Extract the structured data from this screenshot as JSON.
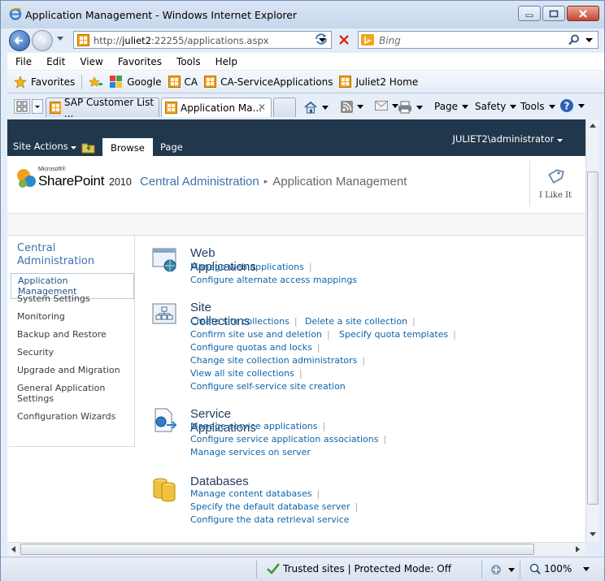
{
  "window": {
    "title": "Application Management - Windows Internet Explorer"
  },
  "address_bar": {
    "url_prefix": "http://",
    "url_host": "juliet2",
    "url_rest": ":22255/applications.aspx"
  },
  "search": {
    "placeholder": "Bing"
  },
  "menu": [
    "File",
    "Edit",
    "View",
    "Favorites",
    "Tools",
    "Help"
  ],
  "favorites_bar": {
    "favorites_label": "Favorites",
    "items": [
      "Google",
      "CA",
      "CA-ServiceApplications",
      "Juliet2 Home"
    ]
  },
  "tabs": {
    "items": [
      {
        "label": "SAP Customer List ..."
      },
      {
        "label": "Application Ma..."
      }
    ],
    "close_glyph": "✕"
  },
  "command_bar": {
    "page": "Page",
    "safety": "Safety",
    "tools": "Tools"
  },
  "ribbon": {
    "site_actions": "Site Actions",
    "tab_browse": "Browse",
    "tab_page": "Page",
    "user": "JULIET2\\administrator"
  },
  "header": {
    "logo_microsoft": "Microsoft®",
    "logo_sharepoint": "SharePoint",
    "logo_version": "2010",
    "breadcrumb_root": "Central Administration",
    "breadcrumb_sep": "▸",
    "breadcrumb_current": "Application Management",
    "i_like_it": "I Like It"
  },
  "left_nav": {
    "heading": "Central Administration",
    "items": [
      "Application Management",
      "System Settings",
      "Monitoring",
      "Backup and Restore",
      "Security",
      "Upgrade and Migration",
      "General Application Settings",
      "Configuration Wizards"
    ]
  },
  "sections": [
    {
      "title": "Web Applications",
      "icon": "web-applications-icon",
      "links": [
        "Manage web applications",
        "Configure alternate access mappings"
      ]
    },
    {
      "title": "Site Collections",
      "icon": "site-collections-icon",
      "links": [
        "Create site collections",
        "Delete a site collection",
        "Confirm site use and deletion",
        "Specify quota templates",
        "Configure quotas and locks",
        "Change site collection administrators",
        "View all site collections",
        "Configure self-service site creation"
      ]
    },
    {
      "title": "Service Applications",
      "icon": "service-applications-icon",
      "links": [
        "Manage service applications",
        "Configure service application associations",
        "Manage services on server"
      ]
    },
    {
      "title": "Databases",
      "icon": "databases-icon",
      "links": [
        "Manage content databases",
        "Specify the default database server",
        "Configure the data retrieval service"
      ]
    }
  ],
  "link_separator": "|",
  "status_bar": {
    "zone": "Trusted sites | Protected Mode: Off",
    "zoom": "100%"
  },
  "colors": {
    "ribbon_bg": "#21374c",
    "link": "#0f64a8",
    "breadcrumb": "#3b73af"
  }
}
